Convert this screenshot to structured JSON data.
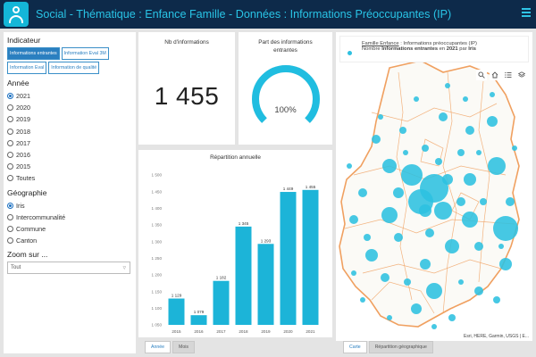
{
  "header": {
    "title": "Social - Thématique : Enfance Famille - Données : Informations Préoccupantes (IP)",
    "logo_icon": "family-icon",
    "menu_icon": "hamburger-menu-icon"
  },
  "left": {
    "indicateur_title": "Indicateur",
    "indicator_buttons": [
      {
        "label": "Informations entrantes",
        "selected": true
      },
      {
        "label": "Information Eval 3M",
        "selected": false
      },
      {
        "label": "Information Eval",
        "selected": false
      },
      {
        "label": "Information de qualité",
        "selected": false
      }
    ],
    "annee_title": "Année",
    "years": [
      {
        "label": "2021",
        "checked": true
      },
      {
        "label": "2020",
        "checked": false
      },
      {
        "label": "2019",
        "checked": false
      },
      {
        "label": "2018",
        "checked": false
      },
      {
        "label": "2017",
        "checked": false
      },
      {
        "label": "2016",
        "checked": false
      },
      {
        "label": "2015",
        "checked": false
      },
      {
        "label": "Toutes",
        "checked": false
      }
    ],
    "geo_title": "Géographie",
    "geos": [
      {
        "label": "Iris",
        "checked": true
      },
      {
        "label": "Intercommunalité",
        "checked": false
      },
      {
        "label": "Commune",
        "checked": false
      },
      {
        "label": "Canton",
        "checked": false
      }
    ],
    "zoom_title": "Zoom sur ...",
    "zoom_value": "Tout"
  },
  "nb_card": {
    "title": "Nb d'informations",
    "value": "1 455"
  },
  "gauge_card": {
    "title": "Part des informations entrantes",
    "percent": 100,
    "label": "100%"
  },
  "chart_card": {
    "tabs": [
      {
        "label": "Année",
        "active": true
      },
      {
        "label": "Mois",
        "active": false
      }
    ]
  },
  "chart_data": {
    "type": "bar",
    "title": "Répartition annuelle",
    "categories": [
      "2015",
      "2016",
      "2017",
      "2018",
      "2019",
      "2020",
      "2021"
    ],
    "values": [
      1129,
      1079,
      1182,
      1345,
      1293,
      1449,
      1455
    ],
    "value_labels": [
      "1 129",
      "1 079",
      "1 182",
      "1 345",
      "1 293",
      "1 449",
      "1 455"
    ],
    "ylim": [
      1050,
      1500
    ],
    "yticks": [
      1050,
      1100,
      1150,
      1200,
      1250,
      1300,
      1350,
      1400,
      1450,
      1500
    ],
    "ytick_labels": [
      "1 050",
      "1 100",
      "1 150",
      "1 200",
      "1 250",
      "1 300",
      "1 350",
      "1 400",
      "1 450",
      "1 500"
    ],
    "xlabel": "",
    "ylabel": "",
    "grid": false,
    "color": "#1cb4d8"
  },
  "map": {
    "legend_link": "Famille Enfance",
    "legend_line1_rest": " : Informations préoccupantes (IP)",
    "legend_line2_pre": "Nombre ",
    "legend_line2_bold1": "Informations entrantes",
    "legend_line2_mid": " en ",
    "legend_line2_bold2": "2021",
    "legend_line2_mid2": " par ",
    "legend_line2_bold3": "Iris",
    "attribution": "Esri, HERE, Garmin, USGS | E...",
    "tools": [
      "search-icon",
      "home-icon",
      "list-icon",
      "layers-icon"
    ],
    "tabs": [
      {
        "label": "Carte",
        "active": true
      },
      {
        "label": "Répartition géographique",
        "active": false
      }
    ],
    "bubble_color": "#2cc0e0",
    "border_color": "#f0a060"
  }
}
